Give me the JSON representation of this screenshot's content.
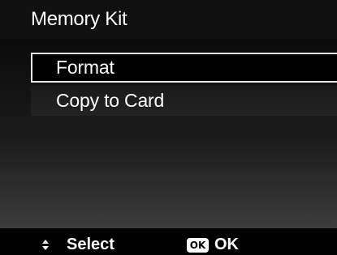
{
  "title": "Memory Kit",
  "menu": {
    "items": [
      {
        "label": "Format",
        "selected": true
      },
      {
        "label": "Copy to Card",
        "selected": false
      }
    ]
  },
  "footer": {
    "nav_icon": "up-down-arrows-icon",
    "select_label": "Select",
    "ok_icon_text": "OK",
    "ok_label": "OK"
  }
}
